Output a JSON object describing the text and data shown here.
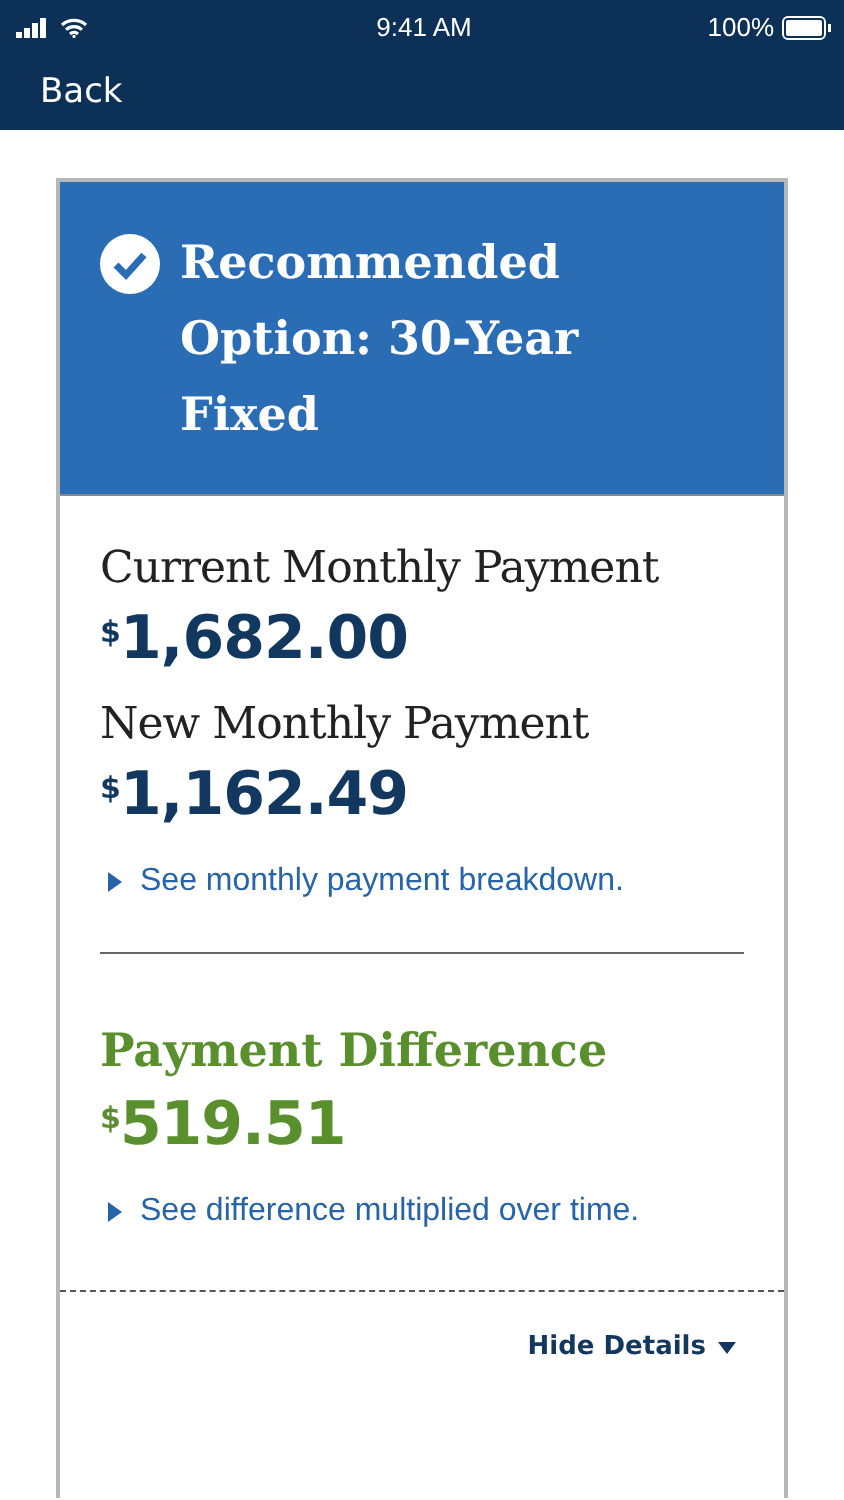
{
  "status_bar": {
    "time": "9:41 AM",
    "battery": "100%"
  },
  "nav": {
    "back": "Back"
  },
  "card": {
    "title": "Recommended Option: 30-Year Fixed",
    "checked": true,
    "payments": [
      {
        "label": "Current Monthly Payment",
        "amount": "$^{$}$1,682.00"
      },
      {
        "label": "New Monthly Payment",
        "amount": "$^{$}$1,162.49"
      }
    ],
    "breakdown_link": "See monthly payment breakdown.",
    "difference": {
      "label": "Payment Difference",
      "amount": "$^{$}$519.51",
      "link": "See difference multiplied over time."
    },
    "toggle": {
      "label": "Hide Details",
      "expanded": true
    }
  }
}
